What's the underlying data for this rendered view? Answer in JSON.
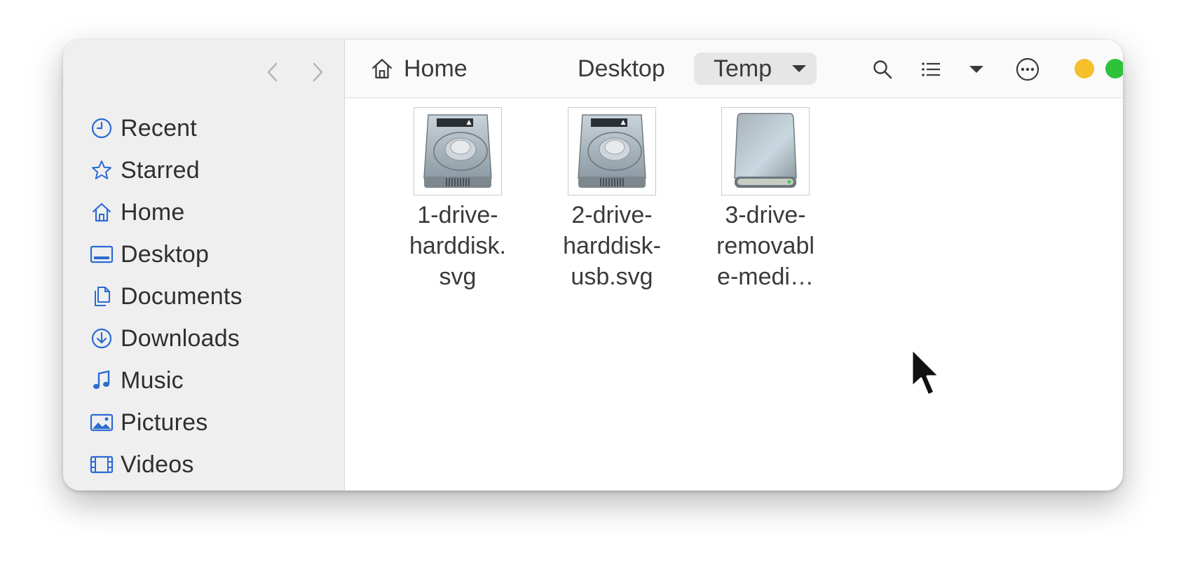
{
  "sidebar": {
    "places": [
      {
        "label": "Recent",
        "icon": "clock-icon"
      },
      {
        "label": "Starred",
        "icon": "star-icon"
      },
      {
        "label": "Home",
        "icon": "home-icon"
      },
      {
        "label": "Desktop",
        "icon": "desktop-icon"
      },
      {
        "label": "Documents",
        "icon": "documents-icon"
      },
      {
        "label": "Downloads",
        "icon": "download-icon"
      },
      {
        "label": "Music",
        "icon": "music-icon"
      },
      {
        "label": "Pictures",
        "icon": "pictures-icon"
      },
      {
        "label": "Videos",
        "icon": "videos-icon"
      }
    ]
  },
  "breadcrumb": {
    "home": "Home",
    "desktop": "Desktop",
    "current": "Temp"
  },
  "files": [
    {
      "name": "1-drive-\nharddisk.\nsvg",
      "icon": "harddisk-icon"
    },
    {
      "name": "2-drive-\nharddisk-\nusb.svg",
      "icon": "harddisk-icon"
    },
    {
      "name": "3-drive-\nremovabl\ne-medi…",
      "icon": "removable-media-icon"
    }
  ],
  "colors": {
    "accent": "#2a6bd1",
    "minimize": "#f5c02c",
    "maximize": "#2ec13a",
    "close": "#f55a4e"
  }
}
